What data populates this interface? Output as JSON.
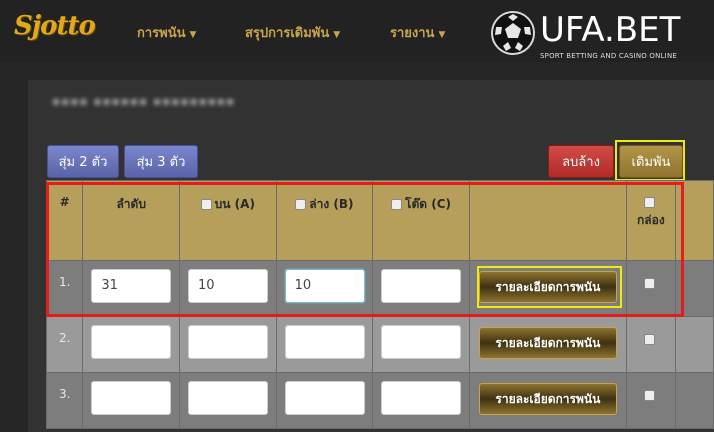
{
  "brand": {
    "logo_text": "Sjotto"
  },
  "nav": {
    "items": [
      {
        "label": "การพนัน",
        "caret": "▼"
      },
      {
        "label": "สรุปการเดิมพัน",
        "caret": "▼"
      },
      {
        "label": "รายงาน",
        "caret": "▼"
      }
    ]
  },
  "partner": {
    "name": "UFA.BET",
    "tagline": "SPORT BETTING AND CASINO ONLINE",
    "icon": "soccer-ball-icon"
  },
  "panel": {
    "title_blurred": "▪▪▪▪ ▪▪▪▪▪▪ ▪▪▪▪▪▪▪▪▪"
  },
  "toolbar": {
    "random2_label": "สุ่ม 2 ตัว",
    "random3_label": "สุ่ม 3 ตัว",
    "clear_label": "ลบล้าง",
    "bet_label": "เดิมพัน"
  },
  "table": {
    "headers": {
      "index": "#",
      "sequence": "ลำดับ",
      "top": "บน (A)",
      "bottom": "ล่าง (B)",
      "tod": "โต๊ด (C)",
      "detail": "",
      "box": "กล่อง"
    },
    "detail_button_label": "รายละเอียดการพนัน",
    "rows": [
      {
        "index": "1.",
        "sequence": "31",
        "top": "10",
        "bottom": "10",
        "tod": ""
      },
      {
        "index": "2.",
        "sequence": "",
        "top": "",
        "bottom": "",
        "tod": ""
      },
      {
        "index": "3.",
        "sequence": "",
        "top": "",
        "bottom": "",
        "tod": ""
      }
    ]
  },
  "colors": {
    "accent_gold": "#b59f5b",
    "highlight_red": "#e51c1c",
    "highlight_yellow": "#f1e90e"
  }
}
